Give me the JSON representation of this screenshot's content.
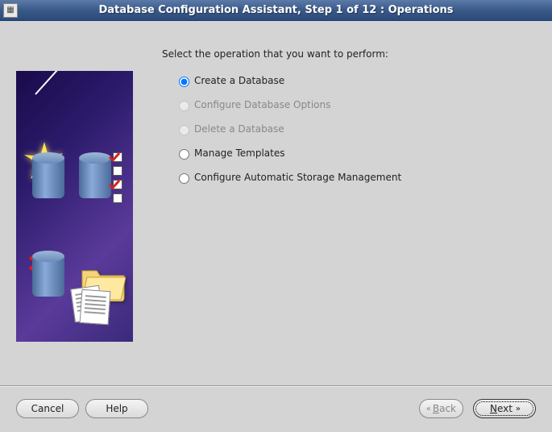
{
  "window": {
    "title": "Database Configuration Assistant, Step 1 of 12 : Operations"
  },
  "main": {
    "prompt": "Select the operation that you want to perform:",
    "options": [
      {
        "id": "create",
        "label": "Create a Database",
        "selected": true,
        "enabled": true
      },
      {
        "id": "config",
        "label": "Configure Database Options",
        "selected": false,
        "enabled": false
      },
      {
        "id": "delete",
        "label": "Delete a Database",
        "selected": false,
        "enabled": false
      },
      {
        "id": "manage",
        "label": "Manage Templates",
        "selected": false,
        "enabled": true
      },
      {
        "id": "asm",
        "label": "Configure Automatic Storage Management",
        "selected": false,
        "enabled": true
      }
    ]
  },
  "buttons": {
    "cancel": "Cancel",
    "help": "Help",
    "back": "Back",
    "next": "Next"
  }
}
